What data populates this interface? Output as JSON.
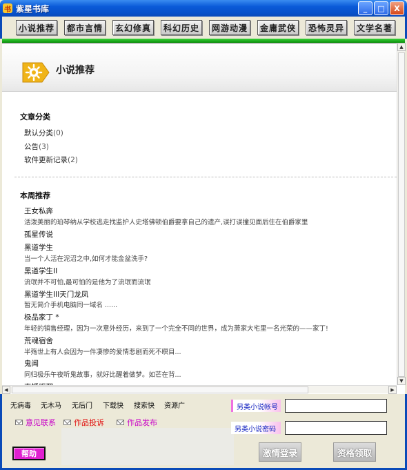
{
  "window": {
    "title": "紫星书库",
    "controls": [
      "_",
      "□",
      "X"
    ]
  },
  "categories": [
    "小说推荐",
    "都市言情",
    "玄幻修真",
    "科幻历史",
    "网游动漫",
    "金庸武侠",
    "恐怖灵异",
    "文学名著"
  ],
  "page": {
    "heading": "小说推荐",
    "article_section_title": "文章分类",
    "article_categories": [
      {
        "name": "默认分类",
        "count": "(0)"
      },
      {
        "name": "公告",
        "count": "(3)"
      },
      {
        "name": "软件更新记录",
        "count": "(2)"
      }
    ],
    "weekly_title": "本周推荐",
    "books": [
      {
        "title": "王女私奔",
        "desc": "活泼美丽的珀琴纳从学校逃走找监护人史塔佛顿伯爵要拿自己的遗产,误打误撞见面后住在伯爵家里"
      },
      {
        "title": "孤星传说",
        "desc": ""
      },
      {
        "title": "黑道学生",
        "desc": "当一个人活在泥沼之中,如何才能金盆洗手?"
      },
      {
        "title": "黑道学生II",
        "desc": "流氓并不可怕,最可怕的是他为了流氓而流氓"
      },
      {
        "title": "黑道学生III天门龙凤",
        "desc": "暂无简介手机电脑同一域名 ......"
      },
      {
        "title": "极品家丁 *",
        "desc": "年轻的销售经理，因为一次意外经历，来到了一个完全不同的世界，成为萧家大宅里一名光荣的——家丁!"
      },
      {
        "title": "荒魂宿舍",
        "desc": "半殇世上有人会因为一件凄惨的爱情悲剧而死不瞑目..."
      },
      {
        "title": "鬼闻",
        "desc": "同归极乐午夜听鬼故事，就好比醒着做梦。如芒在背..."
      },
      {
        "title": "直播驱邪",
        "desc": ""
      }
    ]
  },
  "bottom": {
    "quick_links": [
      "无病毒",
      "无木马",
      "无后门",
      "下载快",
      "搜索快",
      "资源广"
    ],
    "mail_links": [
      {
        "label": "意见联系",
        "color": "#c800c8"
      },
      {
        "label": "作品投诉",
        "color": "#e01010"
      },
      {
        "label": "作品发布",
        "color": "#c800c8"
      }
    ],
    "help_label": "帮助",
    "account_label": "另类小说帐号",
    "password_label": "另类小说密码",
    "login_label": "激情登录",
    "claim_label": "资格领取"
  }
}
